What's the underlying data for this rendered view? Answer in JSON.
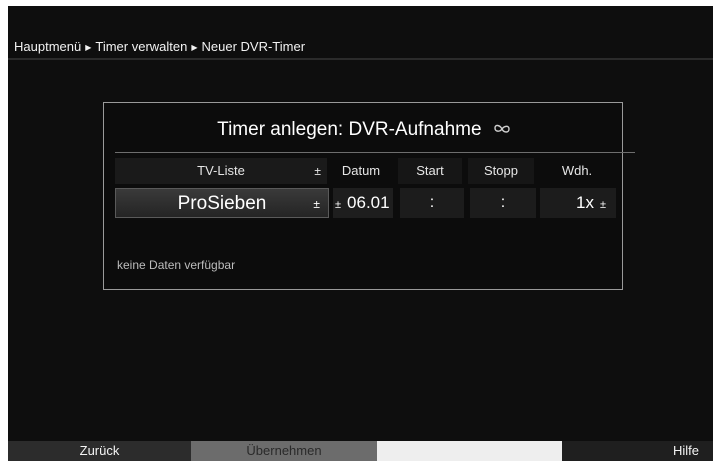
{
  "breadcrumb": {
    "items": [
      "Hauptmenü",
      "Timer verwalten",
      "Neuer DVR-Timer"
    ],
    "separator": "▶"
  },
  "dialog": {
    "title": "Timer anlegen: DVR-Aufnahme",
    "title_icon": "infinity-icon",
    "columns": {
      "tv_liste": "TV-Liste",
      "datum": "Datum",
      "start": "Start",
      "stopp": "Stopp",
      "wdh": "Wdh."
    },
    "values": {
      "channel": "ProSieben",
      "datum": "06.01",
      "start": ":",
      "stopp": ":",
      "wdh": "1x"
    },
    "status": "keine Daten verfügbar"
  },
  "footer": {
    "zurueck": "Zurück",
    "uebernehmen": "Übernehmen",
    "blank": "",
    "hilfe": "Hilfe"
  },
  "colors": {
    "background": "#0e0e0e",
    "selected": "#3a3a3a",
    "footer_gray": "#6c6c6c",
    "footer_white": "#eeeeee"
  }
}
